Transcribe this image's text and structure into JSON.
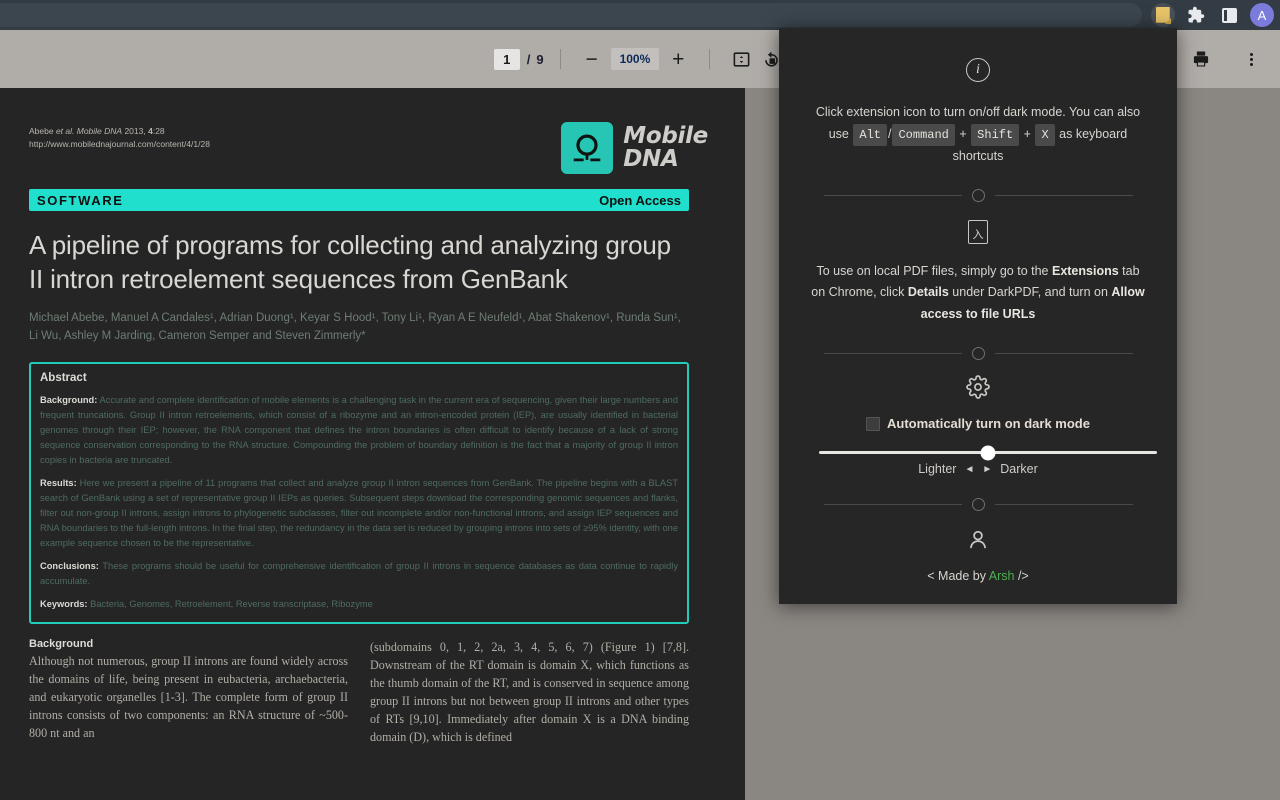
{
  "browser": {
    "omnibox_value": "",
    "actions": [
      {
        "name": "darkpdf-extension-icon",
        "label": "DarkPDF"
      },
      {
        "name": "extensions-puzzle-icon",
        "label": "Extensions"
      },
      {
        "name": "side-panel-icon",
        "label": "Side panel"
      },
      {
        "name": "profile-avatar",
        "label": "A"
      }
    ]
  },
  "pdf_toolbar": {
    "current_page": "1",
    "page_separator": "/",
    "total_pages": "9",
    "zoom_out_label": "−",
    "zoom_level": "100%",
    "zoom_in_label": "+",
    "fit_label": "fit-page-icon",
    "rotate_label": "rotate-counterclockwise-icon",
    "download_label": "download-icon",
    "print_label": "print-icon",
    "more_label": "more-options-icon"
  },
  "document": {
    "citation_line1_prefix": "Abebe ",
    "citation_line1_italic": "et al. Mobile DNA",
    "citation_line1_suffix": " 2013, ",
    "citation_line1_bold": "4",
    "citation_line1_end": ":28",
    "citation_line2": "http://www.mobilednajournal.com/content/4/1/28",
    "journal_logo_line1": "Mobile",
    "journal_logo_line2": "DNA",
    "article_type": "SOFTWARE",
    "access_label": "Open Access",
    "title": "A pipeline of programs for collecting and analyzing group II intron retroelement sequences from GenBank",
    "authors": "Michael Abebe, Manuel A Candales¹, Adrian Duong¹, Keyar S Hood¹, Tony Li¹, Ryan A E Neufeld¹, Abat Shakenov¹, Runda Sun¹, Li Wu, Ashley M Jarding, Cameron Semper and Steven Zimmerly*",
    "abstract_heading": "Abstract",
    "abstract_sections": [
      {
        "label": "Background:",
        "text": " Accurate and complete identification of mobile elements is a challenging task in the current era of sequencing, given their large numbers and frequent truncations. Group II intron retroelements, which consist of a ribozyme and an intron-encoded protein (IEP), are usually identified in bacterial genomes through their IEP; however, the RNA component that defines the intron boundaries is often difficult to identify because of a lack of strong sequence conservation corresponding to the RNA structure. Compounding the problem of boundary definition is the fact that a majority of group II intron copies in bacteria are truncated."
      },
      {
        "label": "Results:",
        "text": " Here we present a pipeline of 11 programs that collect and analyze group II intron sequences from GenBank. The pipeline begins with a BLAST search of GenBank using a set of representative group II IEPs as queries. Subsequent steps download the corresponding genomic sequences and flanks, filter out non-group II introns, assign introns to phylogenetic subclasses, filter out incomplete and/or non-functional introns, and assign IEP sequences and RNA boundaries to the full-length introns. In the final step, the redundancy in the data set is reduced by grouping introns into sets of ≥95% identity, with one example sequence chosen to be the representative."
      },
      {
        "label": "Conclusions:",
        "text": " These programs should be useful for comprehensive identification of group II introns in sequence databases as data continue to rapidly accumulate."
      },
      {
        "label": "Keywords:",
        "text": " Bacteria, Genomes, Retroelement, Reverse transcriptase, Ribozyme"
      }
    ],
    "body_left_heading": "Background",
    "body_left_text": "Although not numerous, group II introns are found widely across the domains of life, being present in eubacteria, archaebacteria, and eukaryotic organelles [1-3]. The complete form of group II introns consists of two components: an RNA structure of ~500-800 nt and an",
    "body_right_text": "(subdomains 0, 1, 2, 2a, 3, 4, 5, 6, 7) (Figure 1) [7,8]. Downstream of the RT domain is domain X, which functions as the thumb domain of the RT, and is conserved in sequence among group II introns but not between group II introns and other types of RTs [9,10]. Immediately after domain X is a DNA binding domain (D), which is defined"
  },
  "panel": {
    "section1": {
      "icon": "info-icon",
      "icon_glyph": "i",
      "line1": "Click extension icon to turn on/off dark mode. You can also use",
      "key_alt": "Alt",
      "key_slash": "/",
      "key_command": "Command",
      "plus1": "+",
      "key_shift": "Shift",
      "plus2": "+",
      "key_x": "X",
      "line2_tail": "as keyboard shortcuts"
    },
    "section2": {
      "icon": "pdf-file-icon",
      "text_part1": "To use on local PDF files, simply go to the ",
      "bold1": "Extensions",
      "text_part2": " tab on Chrome, click ",
      "bold2": "Details",
      "text_part3": " under DarkPDF, and turn on ",
      "bold3": "Allow access to file URLs"
    },
    "section3": {
      "icon": "gear-icon",
      "checkbox_label": "Automatically turn on dark mode",
      "checkbox_checked": false,
      "slider_value": 50,
      "slider_left_label": "Lighter",
      "slider_left_arrow": "◄",
      "slider_right_arrow": "►",
      "slider_right_label": "Darker"
    },
    "section4": {
      "icon": "person-icon",
      "made_by_prefix": "< Made by ",
      "made_by_name": "Arsh",
      "made_by_suffix": " />"
    }
  }
}
